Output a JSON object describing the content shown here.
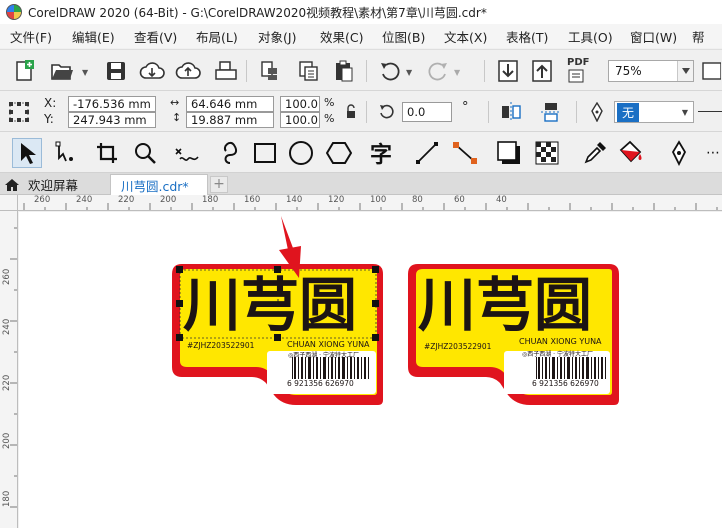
{
  "titlebar": {
    "title": "CorelDRAW 2020 (64-Bit) - G:\\CorelDRAW2020视频教程\\素材\\第7章\\川芎圆.cdr*"
  },
  "menu": [
    "文件(F)",
    "编辑(E)",
    "查看(V)",
    "布局(L)",
    "对象(J)",
    "效果(C)",
    "位图(B)",
    "文本(X)",
    "表格(T)",
    "工具(O)",
    "窗口(W)",
    "帮"
  ],
  "std_toolbar": {
    "zoom": "75%",
    "pdf_label": "PDF"
  },
  "property_bar": {
    "x_label": "X:",
    "y_label": "Y:",
    "x_value": "-176.536 mm",
    "y_value": "247.943 mm",
    "width_value": "64.646 mm",
    "height_value": "19.887 mm",
    "scale_w": "100.0",
    "scale_h": "100.0",
    "percent": "%",
    "rotation": "0.0",
    "degree": "°",
    "outline": "无"
  },
  "tabs": {
    "welcome": "欢迎屏幕",
    "document": "川芎圆.cdr*"
  },
  "ruler": {
    "top": [
      "260",
      "240",
      "220",
      "200",
      "180",
      "160",
      "140",
      "120",
      "100",
      "80",
      "60",
      "40"
    ],
    "left": [
      "260",
      "240",
      "220",
      "200",
      "180"
    ]
  },
  "artwork": {
    "label_left": {
      "title": "川芎圆",
      "code": "#ZJHZ203522901",
      "pinyin": "CHUAN XIONG YUNA",
      "origin": "◎西子西湖 · 宁波特大工厂",
      "barcode": "6 921356 626970"
    },
    "label_right": {
      "title": "川芎圆",
      "code": "#ZJHZ203522901",
      "pinyin": "CHUAN XIONG YUNA",
      "origin": "◎西子西湖 · 宁波特大工厂",
      "barcode": "6 921356 626970"
    }
  },
  "colors": {
    "label_red": "#e0141e",
    "label_yellow": "#ffe700",
    "ink": "#1c1414",
    "accent_blue": "#1a6fc4"
  },
  "icons": [
    "new-document-icon",
    "open-folder-icon",
    "save-icon",
    "cloud-download-icon",
    "cloud-upload-icon",
    "print-icon",
    "undo-icon",
    "redo-icon",
    "import-icon",
    "export-icon",
    "pick-tool-icon",
    "shape-tool-icon",
    "crop-tool-icon",
    "zoom-tool-icon",
    "freehand-tool-icon",
    "artistic-media-icon",
    "rectangle-tool-icon",
    "ellipse-tool-icon",
    "polygon-tool-icon",
    "text-tool-icon",
    "line-tool-icon",
    "connector-tool-icon",
    "drop-shadow-icon",
    "transparency-icon",
    "eyedropper-icon",
    "interactive-fill-icon",
    "pen-icon",
    "lock-ratio-icon"
  ]
}
